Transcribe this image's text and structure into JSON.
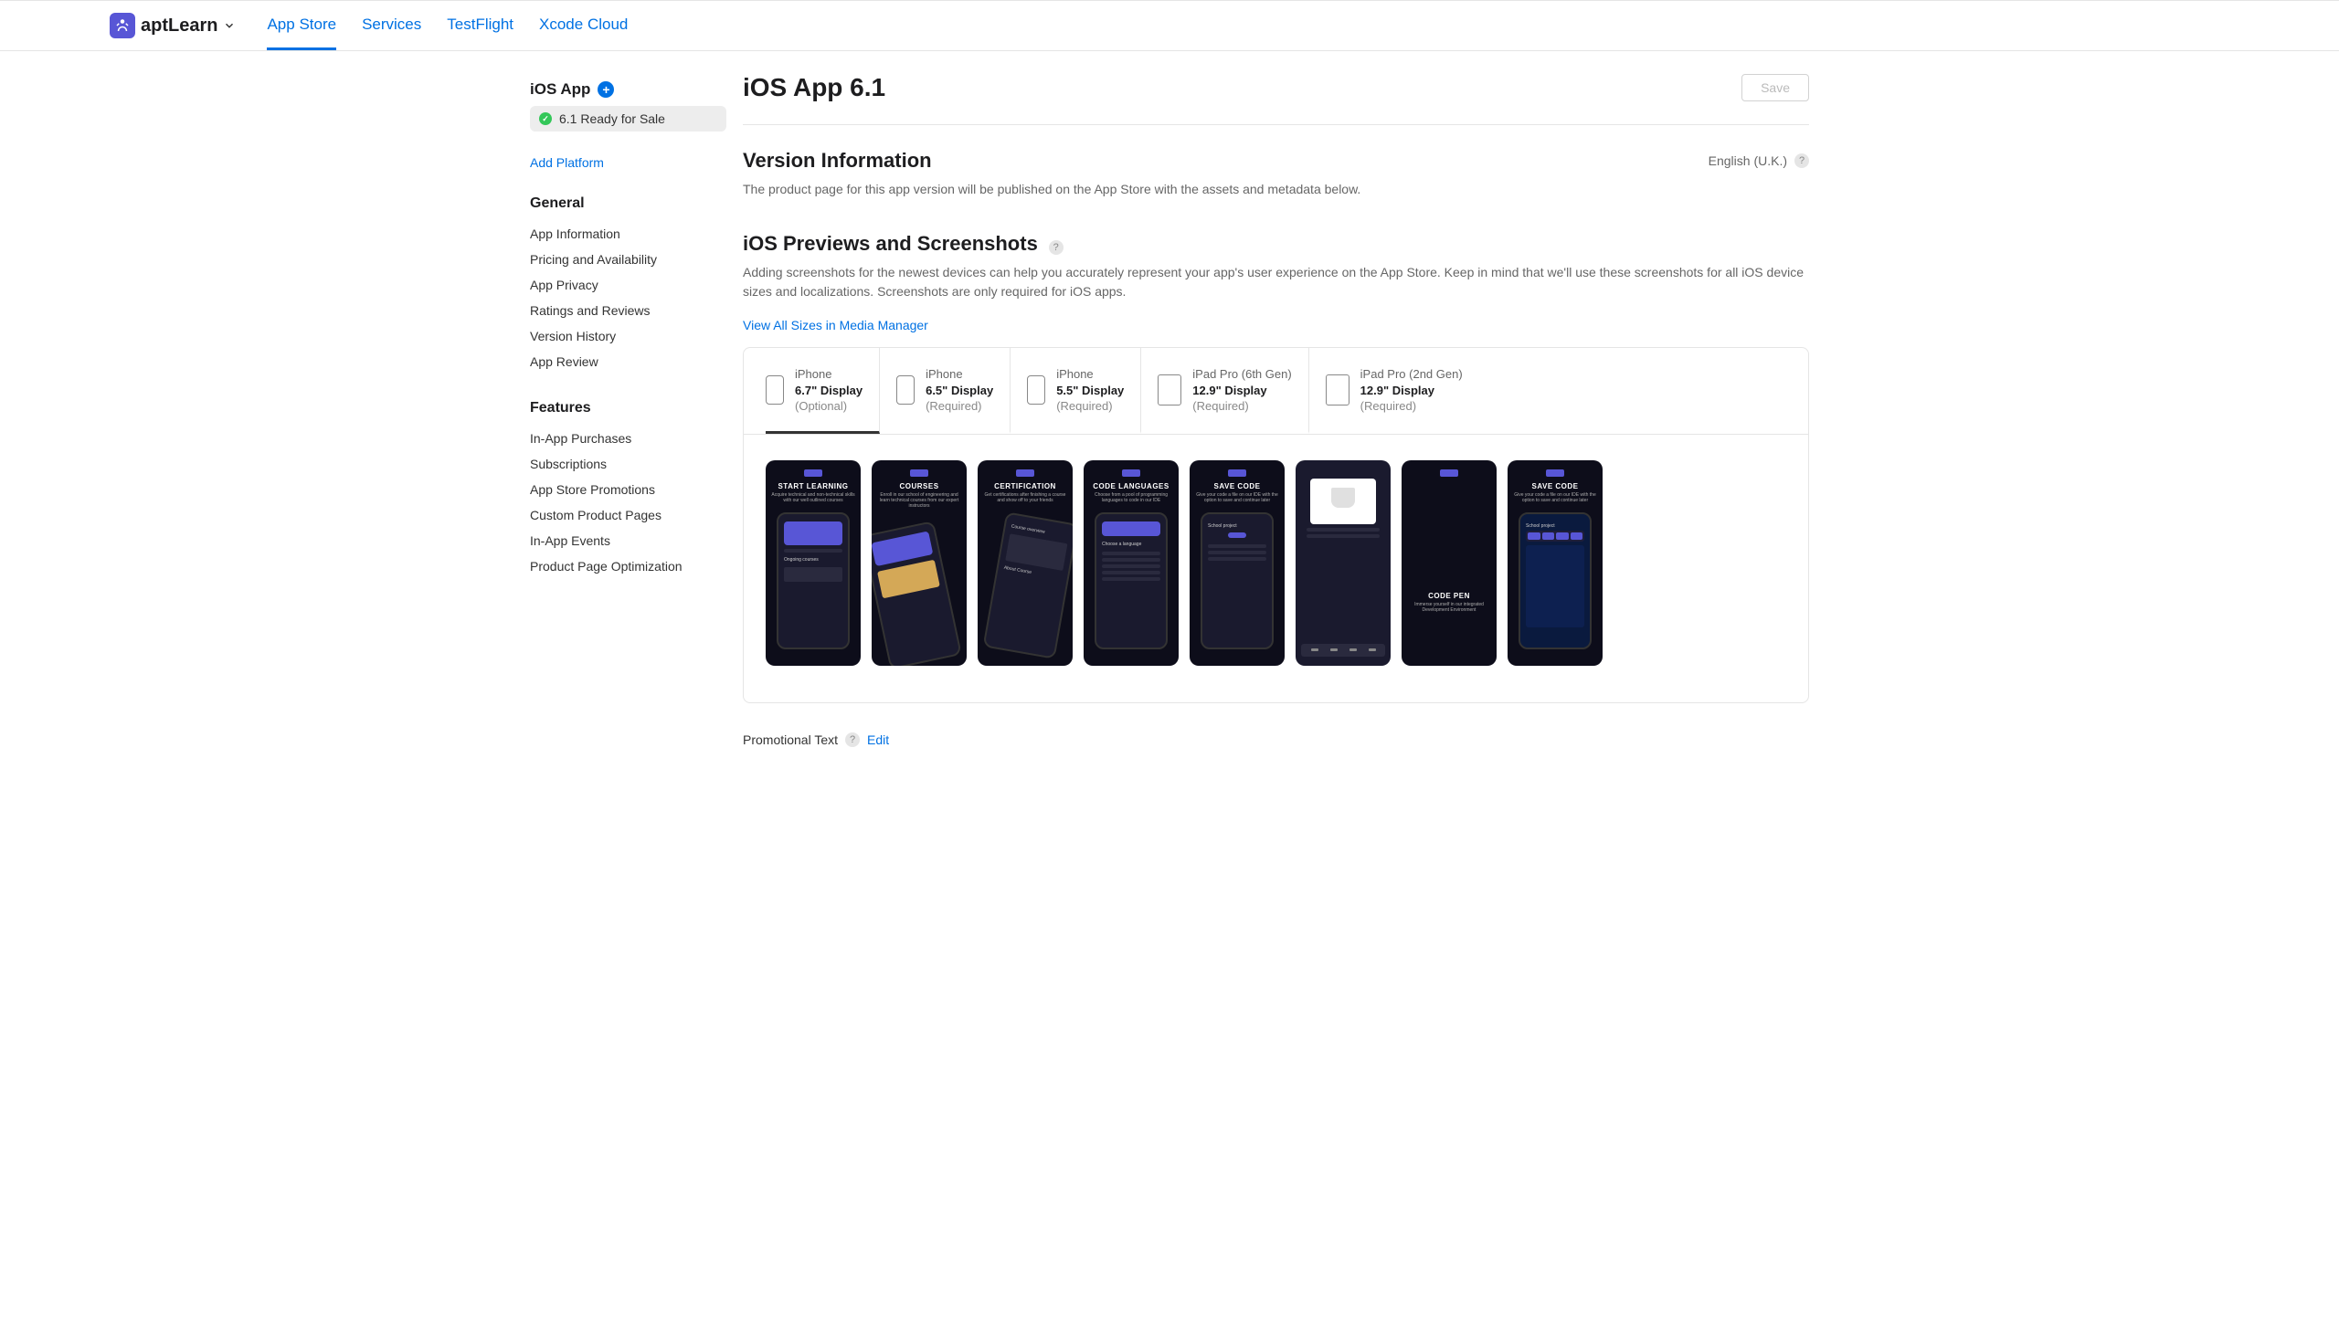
{
  "header": {
    "app_name": "aptLearn",
    "tabs": [
      "App Store",
      "Services",
      "TestFlight",
      "Xcode Cloud"
    ],
    "active_tab": 0
  },
  "sidebar": {
    "app_label": "iOS App",
    "version_status": "6.1 Ready for Sale",
    "add_platform": "Add Platform",
    "general_header": "General",
    "general_items": [
      "App Information",
      "Pricing and Availability",
      "App Privacy",
      "Ratings and Reviews",
      "Version History",
      "App Review"
    ],
    "features_header": "Features",
    "features_items": [
      "In-App Purchases",
      "Subscriptions",
      "App Store Promotions",
      "Custom Product Pages",
      "In-App Events",
      "Product Page Optimization"
    ]
  },
  "main": {
    "title": "iOS App 6.1",
    "save": "Save",
    "version_info_title": "Version Information",
    "language": "English (U.K.)",
    "version_info_desc": "The product page for this app version will be published on the App Store with the assets and metadata below.",
    "previews_title": "iOS Previews and Screenshots",
    "previews_desc": "Adding screenshots for the newest devices can help you accurately represent your app's user experience on the App Store. Keep in mind that we'll use these screenshots for all iOS device sizes and localizations. Screenshots are only required for iOS apps.",
    "media_manager_link": "View All Sizes in Media Manager",
    "device_tabs": [
      {
        "name": "iPhone",
        "display": "6.7\" Display",
        "req": "(Optional)",
        "type": "phone"
      },
      {
        "name": "iPhone",
        "display": "6.5\" Display",
        "req": "(Required)",
        "type": "phone"
      },
      {
        "name": "iPhone",
        "display": "5.5\" Display",
        "req": "(Required)",
        "type": "phone"
      },
      {
        "name": "iPad Pro (6th Gen)",
        "display": "12.9\" Display",
        "req": "(Required)",
        "type": "ipad"
      },
      {
        "name": "iPad Pro (2nd Gen)",
        "display": "12.9\" Display",
        "req": "(Required)",
        "type": "ipad"
      }
    ],
    "screenshots": [
      {
        "title": "START LEARNING",
        "sub": "Acquire technical and non-technical skills with our well outlined courses"
      },
      {
        "title": "COURSES",
        "sub": "Enroll in our school of engineering and learn technical courses from our expert instructors"
      },
      {
        "title": "CERTIFICATION",
        "sub": "Get certifications after finishing a course and show off to your friends"
      },
      {
        "title": "CODE LANGUAGES",
        "sub": "Choose from a pool of programming languages to code in our IDE"
      },
      {
        "title": "SAVE CODE",
        "sub": "Give your code a file on our IDE with the option to save and continue later"
      },
      {
        "title": "",
        "sub": ""
      },
      {
        "title": "CODE PEN",
        "sub": "Immerse yourself in our integrated Development Environment"
      },
      {
        "title": "SAVE CODE",
        "sub": "Give your code a file on our IDE with the option to save and continue later"
      }
    ],
    "promo_label": "Promotional Text",
    "edit": "Edit"
  }
}
